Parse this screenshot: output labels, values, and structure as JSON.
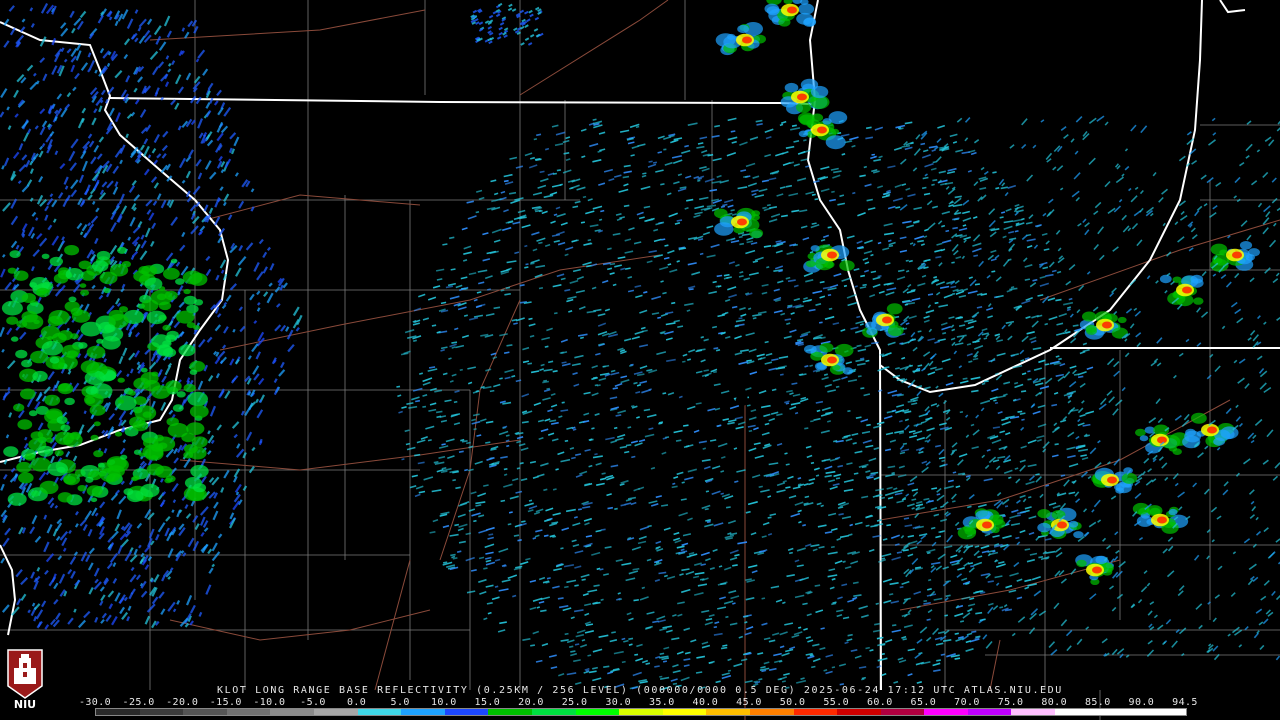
{
  "radar": {
    "caption": "KLOT LONG RANGE BASE REFLECTIVITY (0.25KM / 256 LEVEL) (000000/0000 0.5 DEG) 2025-06-24 17:12 UTC  ATLAS.NIU.EDU"
  },
  "legend": {
    "ticks": [
      "-30.0",
      "-25.0",
      "-20.0",
      "-15.0",
      "-10.0",
      "-5.0",
      "0.0",
      "5.0",
      "10.0",
      "15.0",
      "20.0",
      "25.0",
      "30.0",
      "35.0",
      "40.0",
      "45.0",
      "50.0",
      "55.0",
      "60.0",
      "65.0",
      "70.0",
      "75.0",
      "80.0",
      "85.0",
      "90.0",
      "94.5"
    ],
    "colors": [
      "#2a2a2a",
      "#3c3c3c",
      "#555555",
      "#707070",
      "#8a8a8a",
      "#a6a6a6",
      "#3fd6e6",
      "#1ea2ff",
      "#1c48ff",
      "#00c000",
      "#00e040",
      "#00ff00",
      "#d9ff00",
      "#ffff00",
      "#ffbf00",
      "#ff8000",
      "#ff2a00",
      "#d00000",
      "#b00040",
      "#ff00ff",
      "#c000ff",
      "#ffc0ff",
      "#ffffff",
      "#ffffff",
      "#ffffff"
    ]
  },
  "logo": {
    "text": "NIU"
  },
  "colors": {
    "background": "#000000",
    "state_border": "#ffffff",
    "county_border": "#7a7a7a",
    "road": "#8a4a3a",
    "radar_site": "#000000"
  }
}
